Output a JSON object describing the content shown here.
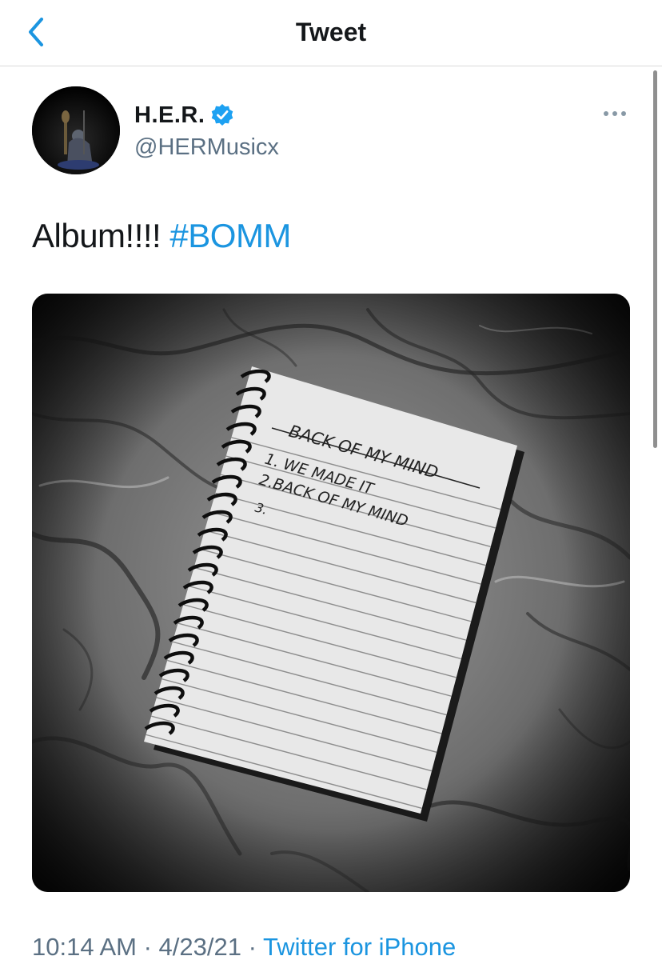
{
  "nav": {
    "title": "Tweet"
  },
  "tweet": {
    "author": {
      "name": "H.E.R.",
      "handle": "@HERMusicx",
      "verified": true
    },
    "text": "Album!!!! ",
    "hashtag": "#BOMM",
    "media": {
      "notebook_title": "BACK OF MY MIND",
      "lines": [
        "1. WE MADE IT",
        "2.BACK OF MY MIND",
        "3."
      ]
    },
    "time": "10:14 AM",
    "separator1": " · ",
    "date": "4/23/21",
    "separator2": " · ",
    "source": "Twitter for iPhone"
  },
  "colors": {
    "link": "#1b95e0",
    "secondary": "#5b7083",
    "divider": "#d9d9d9"
  },
  "icons": {
    "back": "chevron-left-icon",
    "verified": "verified-badge-icon",
    "more": "more-options-icon"
  }
}
